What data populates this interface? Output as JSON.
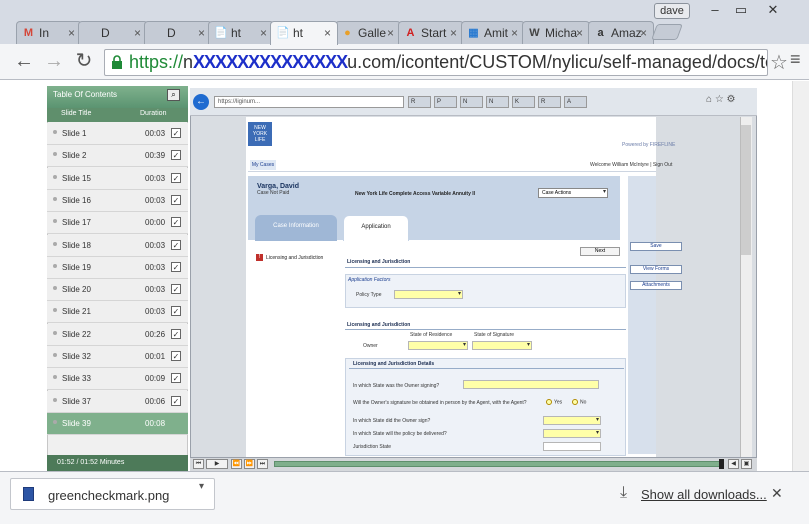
{
  "browser": {
    "user": "dave",
    "window_controls": [
      "–",
      "▭",
      "✕"
    ],
    "tabs": [
      {
        "label": "In",
        "icon": "M",
        "icon_color": "#d44638"
      },
      {
        "label": "D",
        "icon": ""
      },
      {
        "label": "D",
        "icon": ""
      },
      {
        "label": "ht",
        "icon": "📄"
      },
      {
        "label": "ht",
        "icon": "📄",
        "active": true
      },
      {
        "label": "Galle",
        "icon": "●",
        "icon_color": "#e8a02a"
      },
      {
        "label": "Start",
        "icon": "A",
        "icon_color": "#d02020"
      },
      {
        "label": "Amit",
        "icon": "▦",
        "icon_color": "#2a7bd1"
      },
      {
        "label": "Micha",
        "icon": "W",
        "icon_color": "#444"
      },
      {
        "label": "Amaz",
        "icon": "a",
        "icon_color": "#333"
      }
    ],
    "url_scheme": "https://",
    "url_host_prefix": "n",
    "url_obscured": "XXXXXXXXXXXXXX",
    "url_rest": "u.com/icontent/CUSTOM/nylicu/self-managed/docs/test.ann"
  },
  "toc": {
    "title": "Table Of Contents",
    "col_title": "Slide Title",
    "col_duration": "Duration",
    "slides": [
      {
        "label": "Slide 1",
        "duration": "00:03"
      },
      {
        "label": "Slide 2",
        "duration": "00:39"
      },
      {
        "label": "Slide 15",
        "duration": "00:03"
      },
      {
        "label": "Slide 16",
        "duration": "00:03"
      },
      {
        "label": "Slide 17",
        "duration": "00:00"
      },
      {
        "label": "Slide 18",
        "duration": "00:03"
      },
      {
        "label": "Slide 19",
        "duration": "00:03"
      },
      {
        "label": "Slide 20",
        "duration": "00:03"
      },
      {
        "label": "Slide 21",
        "duration": "00:03"
      },
      {
        "label": "Slide 22",
        "duration": "00:26"
      },
      {
        "label": "Slide 32",
        "duration": "00:01"
      },
      {
        "label": "Slide 33",
        "duration": "00:09"
      },
      {
        "label": "Slide 37",
        "duration": "00:06"
      },
      {
        "label": "Slide 39",
        "duration": "00:08",
        "selected": true
      }
    ],
    "time": "01:52 / 01:52 Minutes"
  },
  "recording": {
    "inner_url": "https://liginum...",
    "inner_tabs": [
      "R",
      "P",
      "N",
      "N",
      "K",
      "R",
      "A"
    ],
    "logo_text": "NEW YORK LIFE",
    "powered": "Powered by FIREFLINE",
    "my_cases": "My Cases",
    "welcome": "Welcome William McIntyre | Sign Out",
    "client_name": "Varga, David",
    "client_sub": "Case Not Paid",
    "product": "New York Life Complete Access Variable Annuity II",
    "case_actions": "Case Actions",
    "tab_case_info": "Case Information",
    "tab_application": "Application",
    "side_nav_item": "Licensing and Jurisdiction",
    "next": "Next",
    "section_title": "Licensing and Jurisdiction",
    "app_factors": "Application Factors",
    "policy_type": "Policy Type",
    "lj_subtitle": "Licensing and Jurisdiction",
    "state_residence": "State of Residence",
    "state_signature": "State of Signature",
    "owner": "Owner",
    "lj_details": "Licensing and Jurisdiction Details",
    "q1": "In which State was the Owner signing?",
    "q2": "Will the Owner's signature be obtained in person by the Agent, with the Agent?",
    "yes": "Yes",
    "no": "No",
    "q3": "In which State did the Owner sign?",
    "q4": "In which State will the policy be delivered?",
    "q5": "Jurisdiction State",
    "btn_save": "Save",
    "btn_view_forms": "View Forms",
    "btn_attachments": "Attachments"
  },
  "downloads": {
    "file": "greencheckmark.png",
    "show_all": "Show all downloads..."
  }
}
